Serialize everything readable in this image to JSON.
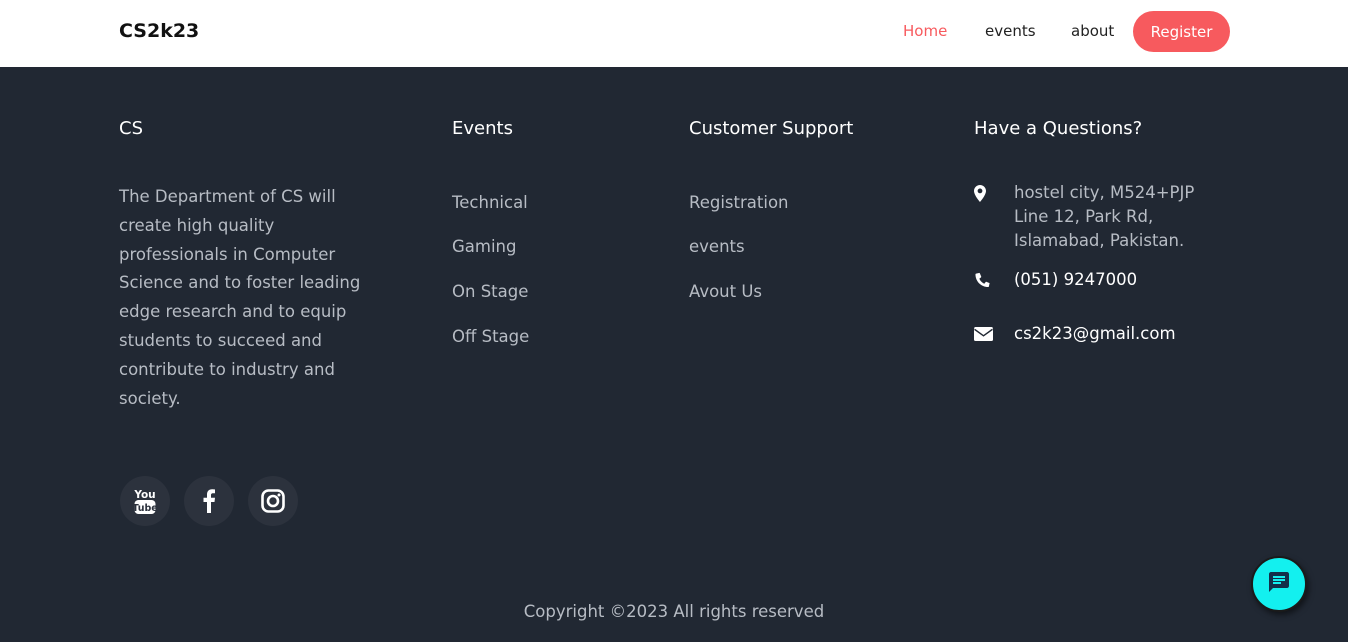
{
  "navbar": {
    "brand": "CS2k23",
    "links": [
      {
        "label": "Home",
        "active": true
      },
      {
        "label": "events",
        "active": false
      },
      {
        "label": "about",
        "active": false
      }
    ],
    "register_label": "Register",
    "accent_color": "#f75a5e"
  },
  "footer": {
    "about": {
      "title": "CS",
      "text": "The Department of CS will create high quality professionals in Computer Science and to foster leading edge research and to equip students to succeed and contribute to industry and society."
    },
    "events": {
      "title": "Events",
      "items": [
        "Technical",
        "Gaming",
        "On Stage",
        "Off Stage"
      ]
    },
    "support": {
      "title": "Customer Support",
      "items": [
        "Registration",
        "events",
        "Avout Us"
      ]
    },
    "contact": {
      "title": "Have a Questions?",
      "address": "hostel city, M524+PJP Line 12, Park Rd, Islamabad, Pakistan.",
      "phone": "(051) 9247000",
      "email": "cs2k23@gmail.com",
      "icons": [
        "map-marker-icon",
        "phone-icon",
        "envelope-icon"
      ]
    },
    "social_icons": [
      "youtube-icon",
      "facebook-icon",
      "instagram-icon"
    ],
    "copyright": "Copyright ©2023 All rights reserved"
  },
  "chat": {
    "icon": "chat-icon",
    "color": "#13f0ef"
  }
}
